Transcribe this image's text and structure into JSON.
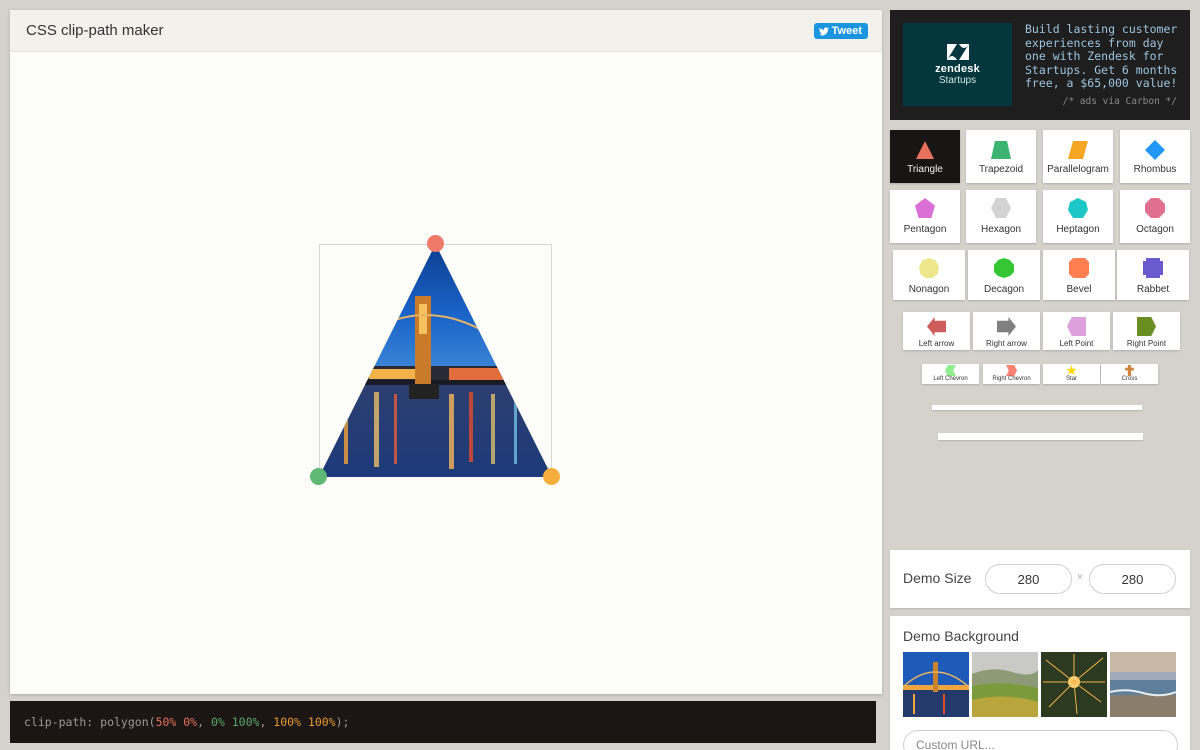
{
  "app": {
    "title": "CSS clip-path maker",
    "tweet_label": "Tweet"
  },
  "code": {
    "prefix": "clip-path: polygon(",
    "points": [
      {
        "text": "50% 0%",
        "color": "#e8715d"
      },
      {
        "text": "0% 100%",
        "color": "#5aa86a"
      },
      {
        "text": "100% 100%",
        "color": "#e99a31"
      }
    ],
    "separator": ", ",
    "suffix": ");"
  },
  "handles": [
    {
      "name": "top-point",
      "color": "#ef7a6b"
    },
    {
      "name": "bottom-left-point",
      "color": "#5fb874"
    },
    {
      "name": "bottom-right-point",
      "color": "#f5ae3c"
    }
  ],
  "ad": {
    "brand": "zendesk",
    "brand_sub": "Startups",
    "text": "Build lasting customer experiences from day one with Zendesk for Startups. Get 6 months free, a $65,000 value!",
    "via": "/* ads via Carbon */"
  },
  "shapes": [
    {
      "label": "Triangle",
      "color": "#e8715d",
      "active": true
    },
    {
      "label": "Trapezoid",
      "color": "#3cb371"
    },
    {
      "label": "Parallelogram",
      "color": "#f5a623"
    },
    {
      "label": "Rhombus",
      "color": "#2196f3"
    },
    {
      "label": "Pentagon",
      "color": "#da70d6"
    },
    {
      "label": "Hexagon",
      "color": "#d3d3d3"
    },
    {
      "label": "Heptagon",
      "color": "#1dc7c7"
    },
    {
      "label": "Octagon",
      "color": "#e0708f"
    },
    {
      "label": "Nonagon",
      "color": "#eee68a"
    },
    {
      "label": "Decagon",
      "color": "#35c535"
    },
    {
      "label": "Bevel",
      "color": "#ff7f50"
    },
    {
      "label": "Rabbet",
      "color": "#6a5acd"
    },
    {
      "label": "Left arrow",
      "color": "#cd5c5c"
    },
    {
      "label": "Right arrow",
      "color": "#808080"
    },
    {
      "label": "Left Point",
      "color": "#dda0dd"
    },
    {
      "label": "Right Point",
      "color": "#6b8e23"
    },
    {
      "label": "Left Chevron",
      "color": "#90ee90"
    },
    {
      "label": "Right Chevron",
      "color": "#fa8072"
    },
    {
      "label": "Star",
      "color": "#ffd700"
    },
    {
      "label": "Cross",
      "color": "#cd853f"
    }
  ],
  "demo_size": {
    "label": "Demo Size",
    "width": "280",
    "height": "280",
    "separator": "×"
  },
  "demo_background": {
    "label": "Demo Background",
    "thumbnails": [
      "bridge",
      "countryside",
      "sparkler",
      "beach"
    ],
    "custom_placeholder": "Custom URL..."
  }
}
